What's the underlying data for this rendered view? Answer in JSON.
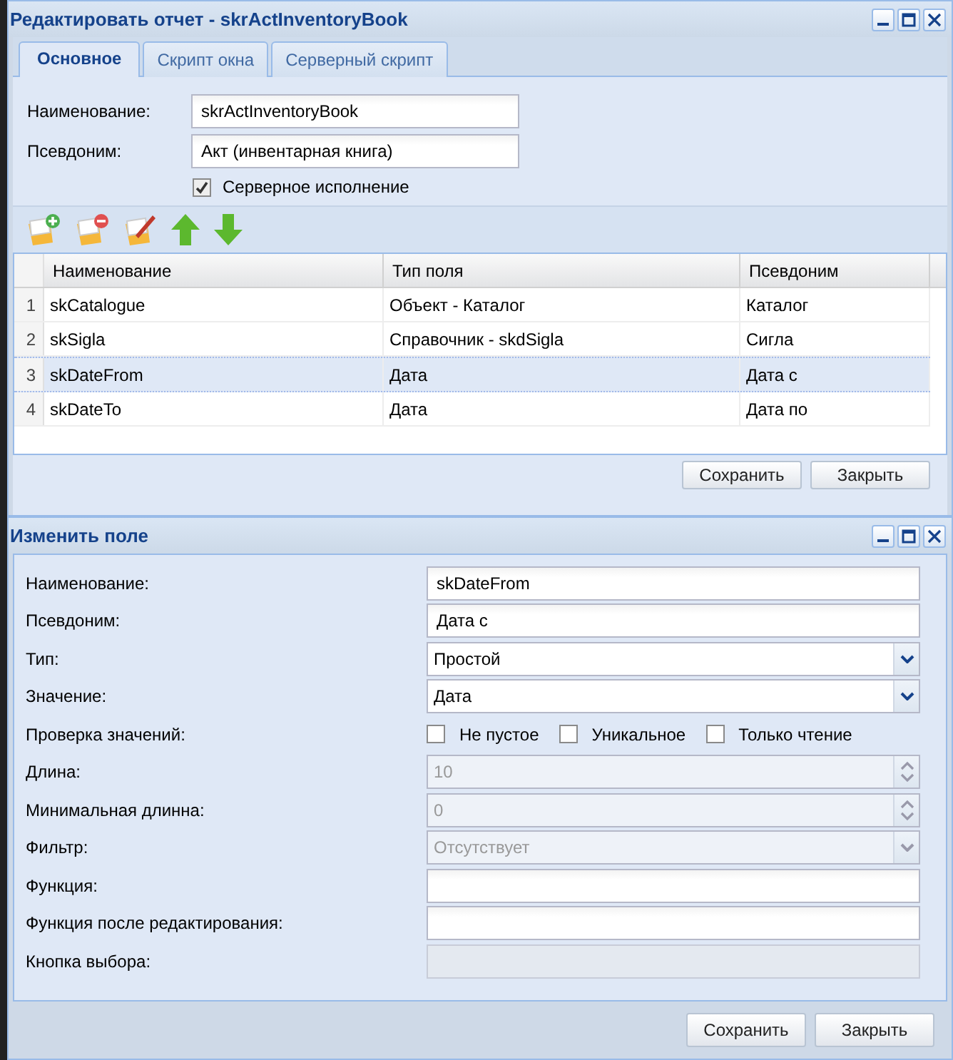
{
  "main_window": {
    "title": "Редактировать отчет - skrActInventoryBook",
    "tabs": [
      {
        "label": "Основное",
        "selected": true
      },
      {
        "label": "Скрипт окна",
        "selected": false
      },
      {
        "label": "Серверный скрипт",
        "selected": false
      }
    ],
    "fields": [
      {
        "label": "Наименование:",
        "value": "skrActInventoryBook"
      },
      {
        "label": "Псевдоним:",
        "value": "Акт (инвентарная книга)"
      }
    ],
    "server_execution": {
      "label": "Серверное исполнение",
      "checked": true
    },
    "table": {
      "columns": [
        "Наименование",
        "Тип поля",
        "Псевдоним"
      ],
      "rows": [
        {
          "number": "1",
          "cells": [
            "skCatalogue",
            "Объект - Каталог",
            "Каталог"
          ],
          "selected": false
        },
        {
          "number": "2",
          "cells": [
            "skSigla",
            "Справочник - skdSigla",
            "Сигла"
          ],
          "selected": false
        },
        {
          "number": "3",
          "cells": [
            "skDateFrom",
            "Дата",
            "Дата с"
          ],
          "selected": true
        },
        {
          "number": "4",
          "cells": [
            "skDateTo",
            "Дата",
            "Дата по"
          ],
          "selected": false
        }
      ]
    },
    "buttons": [
      "Сохранить",
      "Закрыть"
    ]
  },
  "edit_window": {
    "title": "Изменить поле",
    "fields": [
      {
        "kind": "text",
        "label": "Наименование:",
        "value": "skDateFrom",
        "disabled": false
      },
      {
        "kind": "text",
        "label": "Псевдоним:",
        "value": "Дата с",
        "disabled": false
      },
      {
        "kind": "combo",
        "label": "Тип:",
        "value": "Простой",
        "disabled": false
      },
      {
        "kind": "combo",
        "label": "Значение:",
        "value": "Дата",
        "disabled": false
      },
      {
        "kind": "checks",
        "label": "Проверка значений:",
        "options": [
          {
            "label": "Не пустое",
            "checked": false
          },
          {
            "label": "Уникальное",
            "checked": false
          },
          {
            "label": "Только чтение",
            "checked": false
          }
        ]
      },
      {
        "kind": "spinner",
        "label": "Длина:",
        "value": "10",
        "disabled": true
      },
      {
        "kind": "spinner",
        "label": "Минимальная длинна:",
        "value": "0",
        "disabled": true
      },
      {
        "kind": "combo",
        "label": "Фильтр:",
        "value": "Отсутствует",
        "disabled": true
      },
      {
        "kind": "text",
        "label": "Функция:",
        "disabled": false
      },
      {
        "kind": "text",
        "label": "Функция после редактирования:",
        "disabled": false
      },
      {
        "kind": "text",
        "label": "Кнопка выбора:",
        "disabled": true
      }
    ],
    "buttons": [
      "Сохранить",
      "Закрыть"
    ]
  }
}
